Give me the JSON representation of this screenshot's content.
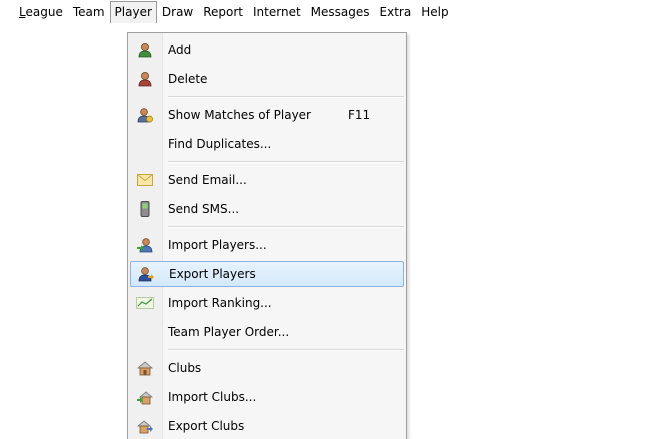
{
  "menubar": {
    "items": [
      {
        "label": "League",
        "accel": "L",
        "rest": "eague"
      },
      {
        "label": "Team"
      },
      {
        "label": "Player"
      },
      {
        "label": "Draw"
      },
      {
        "label": "Report"
      },
      {
        "label": "Internet"
      },
      {
        "label": "Messages"
      },
      {
        "label": "Extra"
      },
      {
        "label": "Help"
      }
    ],
    "open_item": "Player"
  },
  "player_menu": {
    "items": [
      {
        "label": "Add",
        "icon": "user-add-icon"
      },
      {
        "label": "Delete",
        "icon": "user-delete-icon"
      },
      {
        "label": "Show Matches of Player",
        "shortcut": "F11",
        "icon": "user-matches-icon"
      },
      {
        "label": "Find Duplicates...",
        "icon": ""
      },
      {
        "label": "Send Email...",
        "icon": "envelope-icon"
      },
      {
        "label": "Send SMS...",
        "icon": "mobile-phone-icon"
      },
      {
        "label": "Import Players...",
        "icon": "import-players-icon"
      },
      {
        "label": "Export Players",
        "icon": "export-players-icon",
        "highlighted": true
      },
      {
        "label": "Import Ranking...",
        "icon": "ranking-chart-icon"
      },
      {
        "label": "Team Player Order...",
        "icon": ""
      },
      {
        "label": "Clubs",
        "icon": "club-house-icon"
      },
      {
        "label": "Import Clubs...",
        "icon": "import-clubs-icon"
      },
      {
        "label": "Export Clubs",
        "icon": "export-clubs-icon"
      }
    ]
  },
  "colors": {
    "highlight_border": "#8db2e3",
    "highlight_fill": "#d3e8fb",
    "menu_background": "#f6f6f6"
  }
}
